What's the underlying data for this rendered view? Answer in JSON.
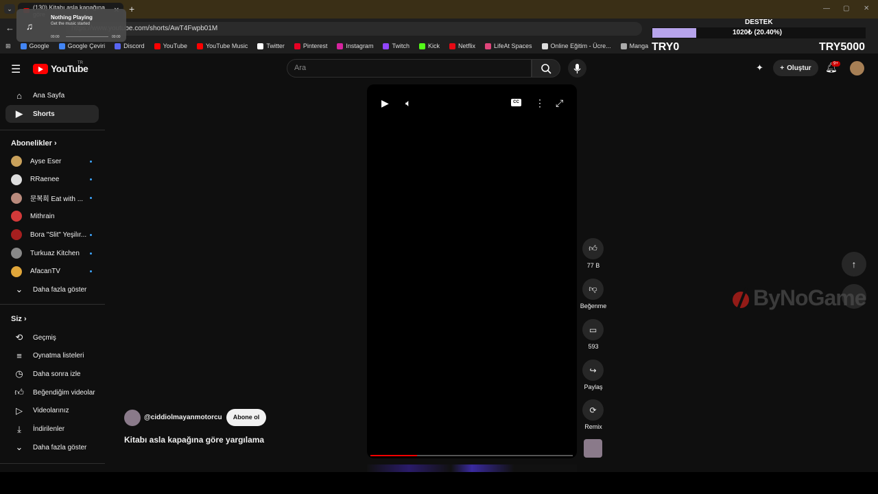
{
  "browser": {
    "tab_title": "(130) Kitabı asla kapağına göre",
    "url": "https://www.youtube.com/shorts/AwT4Fwpb01M",
    "bookmarks": [
      {
        "label": "Google",
        "color": "#4285f4"
      },
      {
        "label": "Google Çeviri",
        "color": "#4285f4"
      },
      {
        "label": "Discord",
        "color": "#5865f2"
      },
      {
        "label": "YouTube",
        "color": "#ff0000"
      },
      {
        "label": "YouTube Music",
        "color": "#ff0000"
      },
      {
        "label": "Twitter",
        "color": "#ffffff"
      },
      {
        "label": "Pinterest",
        "color": "#e60023"
      },
      {
        "label": "Instagram",
        "color": "#d6249f"
      },
      {
        "label": "Twitch",
        "color": "#9146ff"
      },
      {
        "label": "Kick",
        "color": "#53fc18"
      },
      {
        "label": "Netflix",
        "color": "#e50914"
      },
      {
        "label": "LifeAt Spaces",
        "color": "#e0457b"
      },
      {
        "label": "Online Eğitim - Ücre...",
        "color": "#dddddd"
      },
      {
        "label": "Manga",
        "color": "#aaaaaa"
      }
    ]
  },
  "music_popup": {
    "title": "Nothing Playing",
    "subtitle": "Get the music started",
    "time_start": "00:00",
    "time_end": "00:00"
  },
  "overlay": {
    "destek_title": "DESTEK",
    "destek_value": "1020₺ (20.40%)",
    "progress_fraction": 0.204,
    "left_label": "TRY0",
    "right_label": "TRY5000",
    "watermark": "ByNoGame"
  },
  "header": {
    "logo_text": "YouTube",
    "region": "TR",
    "search_placeholder": "Ara",
    "create_label": "Oluştur",
    "notifications_badge": "9+"
  },
  "sidebar": {
    "main": [
      {
        "label": "Ana Sayfa",
        "icon": "home-icon"
      },
      {
        "label": "Shorts",
        "icon": "shorts-icon",
        "active": true
      }
    ],
    "subscriptions_heading": "Abonelikler",
    "subscriptions": [
      {
        "label": "Ayse Eser",
        "color": "#c9a15b",
        "dot": true
      },
      {
        "label": "RRaenee",
        "color": "#dddddd",
        "dot": true
      },
      {
        "label": "문복희 Eat with ...",
        "color": "#b98a7c",
        "dot": true
      },
      {
        "label": "Mithrain",
        "color": "#d33a3a",
        "dot": false
      },
      {
        "label": "Bora \"Slit\" Yeşilır...",
        "color": "#a51f1f",
        "dot": true
      },
      {
        "label": "Turkuaz Kitchen",
        "color": "#888888",
        "dot": true
      },
      {
        "label": "AfacanTV",
        "color": "#e0a63a",
        "dot": true
      }
    ],
    "show_more_1": "Daha fazla göster",
    "you_heading": "Siz",
    "you_items": [
      {
        "label": "Geçmiş",
        "icon": "history-icon"
      },
      {
        "label": "Oynatma listeleri",
        "icon": "playlists-icon"
      },
      {
        "label": "Daha sonra izle",
        "icon": "watch-later-icon"
      },
      {
        "label": "Beğendiğim videolar",
        "icon": "liked-icon"
      },
      {
        "label": "Videolarınız",
        "icon": "your-videos-icon"
      },
      {
        "label": "İndirilenler",
        "icon": "downloads-icon"
      }
    ],
    "show_more_2": "Daha fazla göster"
  },
  "player": {
    "progress_fraction": 0.23
  },
  "actions": {
    "likes": "77 B",
    "dislike_label": "Beğenme",
    "comments": "593",
    "share_label": "Paylaş",
    "remix_label": "Remix"
  },
  "video": {
    "channel": "@ciddiolmayanmotorcu",
    "subscribe_label": "Abone ol",
    "title": "Kitabı asla kapağına göre yargılama"
  }
}
